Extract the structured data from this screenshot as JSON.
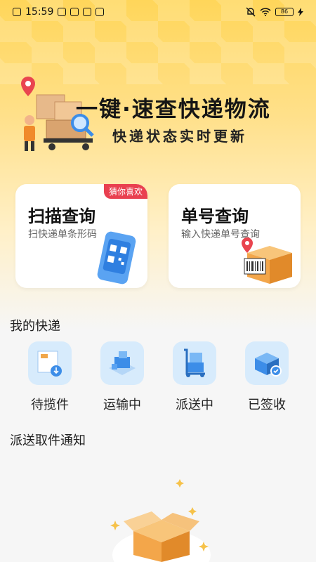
{
  "status_bar": {
    "time": "15:59",
    "battery": "86"
  },
  "banner": {
    "title": "一键·速查快递物流",
    "subtitle": "快递状态实时更新"
  },
  "cards": [
    {
      "title": "扫描查询",
      "subtitle": "扫快递单条形码",
      "badge": "猜你喜欢"
    },
    {
      "title": "单号查询",
      "subtitle": "输入快递单号查询"
    }
  ],
  "my_express": {
    "title": "我的快递",
    "items": [
      {
        "label": "待揽件",
        "icon": "pending-pickup-icon"
      },
      {
        "label": "运输中",
        "icon": "in-transit-icon"
      },
      {
        "label": "派送中",
        "icon": "delivering-icon"
      },
      {
        "label": "已签收",
        "icon": "signed-icon"
      }
    ]
  },
  "notify": {
    "title": "派送取件通知"
  },
  "colors": {
    "accent_yellow": "#ffd65a",
    "badge_red": "#e94050",
    "icon_blue": "#3c8de8"
  }
}
